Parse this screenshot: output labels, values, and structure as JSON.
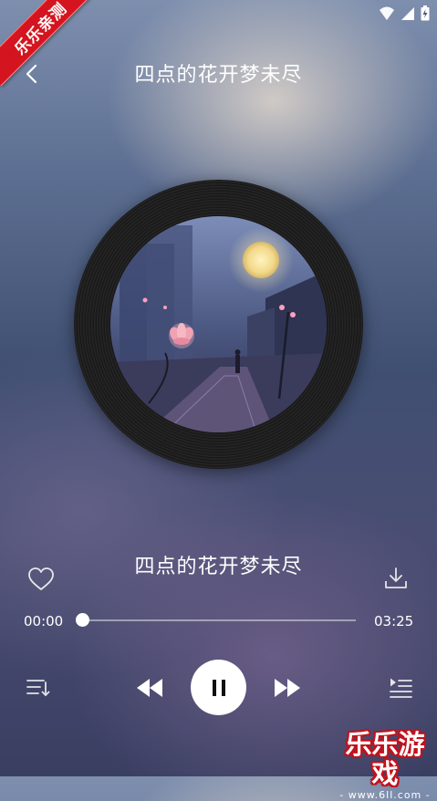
{
  "status_bar": {
    "icons": [
      "wifi-icon",
      "cellular-signal-icon",
      "battery-icon"
    ]
  },
  "ribbon": {
    "label": "乐乐亲测"
  },
  "header": {
    "back_icon": "chevron-left-icon",
    "title": "四点的花开梦未尽"
  },
  "album": {
    "cover_description_icon": "album-art"
  },
  "song": {
    "title": "四点的花开梦未尽",
    "liked_icon": "heart-outline-icon",
    "download_icon": "download-icon"
  },
  "progress": {
    "current": "00:00",
    "total": "03:25",
    "fraction": 0.0
  },
  "controls": {
    "playlist_icon": "playlist-icon",
    "prev_icon": "previous-icon",
    "play_icon": "pause-icon",
    "next_icon": "next-icon",
    "queue_icon": "queue-icon"
  },
  "watermark": {
    "main": "乐乐游戏",
    "url": "- www.6ll.com -"
  },
  "colors": {
    "ribbon": "#d4141e",
    "watermark_outline": "#c2121c",
    "background_top": "#7e8fae",
    "background_bottom": "#3a3f62"
  }
}
